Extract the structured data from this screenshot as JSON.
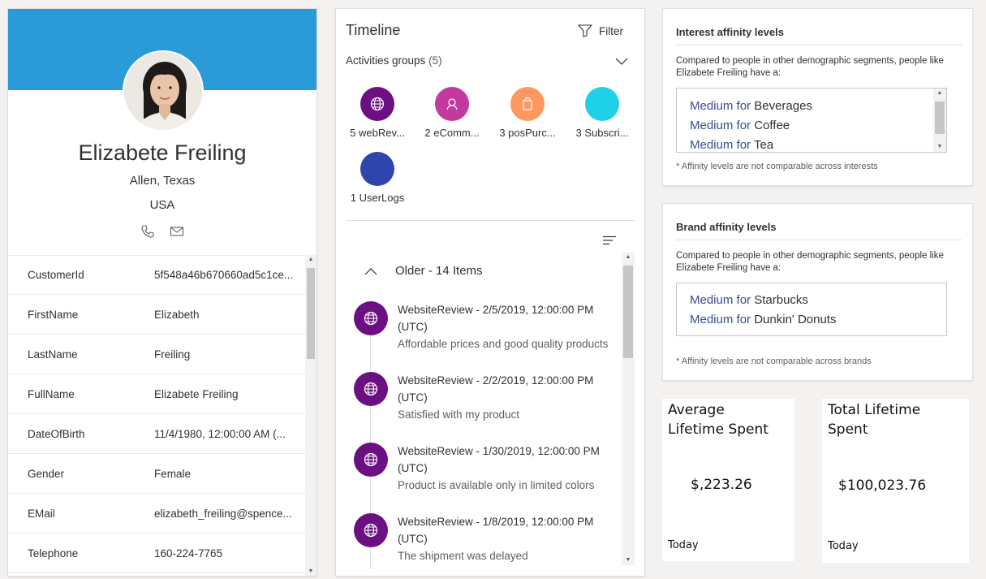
{
  "profile": {
    "full_name": "Elizabete Freiling",
    "city": "Allen, Texas",
    "country": "USA",
    "contact_icons": [
      "phone-icon",
      "mail-icon"
    ],
    "fields": [
      {
        "key": "CustomerId",
        "value": "5f548a46b670660ad5c1ce..."
      },
      {
        "key": "FirstName",
        "value": "Elizabeth"
      },
      {
        "key": "LastName",
        "value": "Freiling"
      },
      {
        "key": "FullName",
        "value": "Elizabete Freiling"
      },
      {
        "key": "DateOfBirth",
        "value": "11/4/1980, 12:00:00 AM (..."
      },
      {
        "key": "Gender",
        "value": "Female"
      },
      {
        "key": "EMail",
        "value": "elizabeth_freiling@spence..."
      },
      {
        "key": "Telephone",
        "value": "160-224-7765"
      }
    ],
    "banner_color": "#2b9ad9"
  },
  "timeline": {
    "title": "Timeline",
    "filter_label": "Filter",
    "groups_label": "Activities groups",
    "groups_count": "(5)",
    "activity_groups": [
      {
        "label": "5 webRev...",
        "color": "#6b0f82",
        "icon": "globe-icon"
      },
      {
        "label": "2 eComm...",
        "color": "#c4399e",
        "icon": "person-icon"
      },
      {
        "label": "3 posPurc...",
        "color": "#ff9761",
        "icon": "bag-icon"
      },
      {
        "label": "3 Subscri...",
        "color": "#1fd1e8",
        "icon": "none"
      },
      {
        "label": "1 UserLogs",
        "color": "#3044ad",
        "icon": "none"
      }
    ],
    "older_label": "Older - 14 Items",
    "items": [
      {
        "title": "WebsiteReview - 2/5/2019, 12:00:00 PM",
        "tz": "(UTC)",
        "desc": "Affordable prices and good quality products"
      },
      {
        "title": "WebsiteReview - 2/2/2019, 12:00:00 PM",
        "tz": "(UTC)",
        "desc": "Satisfied with my product"
      },
      {
        "title": "WebsiteReview - 1/30/2019, 12:00:00 PM",
        "tz": "(UTC)",
        "desc": "Product is available only in limited colors"
      },
      {
        "title": "WebsiteReview - 1/8/2019, 12:00:00 PM",
        "tz": "(UTC)",
        "desc": "The shipment was delayed"
      }
    ]
  },
  "interest": {
    "title": "Interest affinity levels",
    "subtitle": "Compared to people in other demographic segments, people like Elizabete Freiling have a:",
    "items": [
      {
        "level": "Medium",
        "for": "for",
        "category": "Beverages"
      },
      {
        "level": "Medium",
        "for": "for",
        "category": "Coffee"
      },
      {
        "level": "Medium",
        "for": "for",
        "category": "Tea"
      }
    ],
    "note": "* Affinity levels are not comparable across interests"
  },
  "brand": {
    "title": "Brand affinity levels",
    "subtitle": "Compared to people in other demographic segments, people like Elizabete Freiling have a:",
    "items": [
      {
        "level": "Medium",
        "for": "for",
        "category": "Starbucks"
      },
      {
        "level": "Medium",
        "for": "for",
        "category": "Dunkin' Donuts"
      }
    ],
    "note": "* Affinity levels are not comparable across brands"
  },
  "kpis": {
    "avg": {
      "title_line1": "Average",
      "title_line2": "Lifetime Spent",
      "value": "$,223.26",
      "period": "Today"
    },
    "total": {
      "title_line1": "Total Lifetime",
      "title_line2": "Spent",
      "value": "$100,023.76",
      "period": "Today"
    }
  }
}
